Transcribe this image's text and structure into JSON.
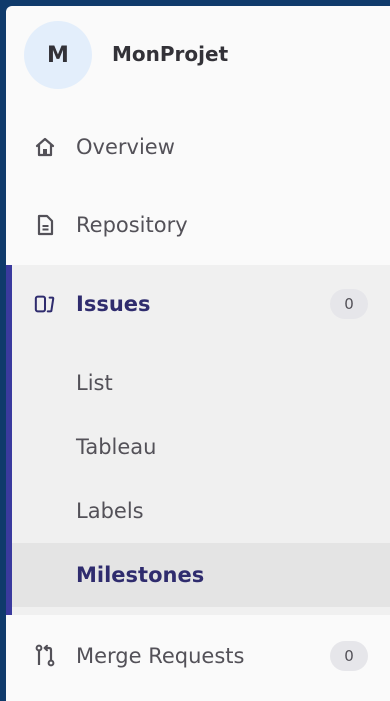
{
  "project": {
    "initial": "M",
    "name": "MonProjet"
  },
  "nav": {
    "overview": {
      "label": "Overview",
      "icon": "home-icon"
    },
    "repository": {
      "label": "Repository",
      "icon": "document-icon"
    },
    "issues": {
      "label": "Issues",
      "icon": "issues-icon",
      "count": "0",
      "sub_items": [
        {
          "label": "List"
        },
        {
          "label": "Tableau"
        },
        {
          "label": "Labels"
        },
        {
          "label": "Milestones",
          "active": true
        }
      ]
    },
    "merge_requests": {
      "label": "Merge Requests",
      "icon": "merge-request-icon",
      "count": "0"
    }
  },
  "colors": {
    "frame": "#0f3a6b",
    "accent": "#3a3a9e",
    "active_text": "#2f2c6e",
    "sidebar_bg": "#fafafa",
    "group_bg": "#f0f0f0"
  }
}
